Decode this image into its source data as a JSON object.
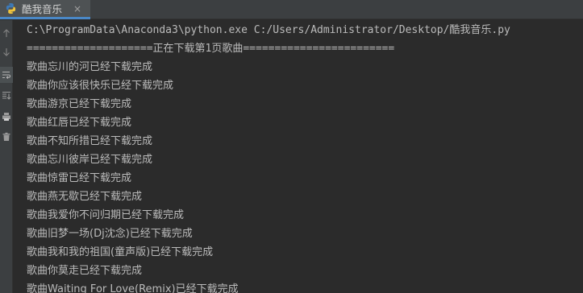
{
  "tab": {
    "title": "酷我音乐",
    "close": "×",
    "icon": "python-icon"
  },
  "toolbar": {
    "icons": [
      "arrow-up-icon",
      "arrow-down-icon",
      "soft-wrap-icon",
      "scroll-to-end-icon",
      "print-icon",
      "trash-icon"
    ]
  },
  "colors": {
    "background": "#2b2b2b",
    "text": "#bbbbbb",
    "tab_accent": "#4a88c7"
  },
  "console": {
    "command": "C:\\ProgramData\\Anaconda3\\python.exe C:/Users/Administrator/Desktop/酷我音乐.py",
    "header": "====================正在下载第1页歌曲========================",
    "lines": [
      "歌曲忘川的河已经下载完成",
      "歌曲你应该很快乐已经下载完成",
      "歌曲游京已经下载完成",
      "歌曲红唇已经下载完成",
      "歌曲不知所措已经下载完成",
      "歌曲忘川彼岸已经下载完成",
      "歌曲惊雷已经下载完成",
      "歌曲燕无歇已经下载完成",
      "歌曲我爱你不问归期已经下载完成",
      "歌曲旧梦一场(Dj沈念)已经下载完成",
      "歌曲我和我的祖国(童声版)已经下载完成",
      "歌曲你莫走已经下载完成",
      "歌曲Waiting For Love(Remix)已经下载完成"
    ]
  }
}
